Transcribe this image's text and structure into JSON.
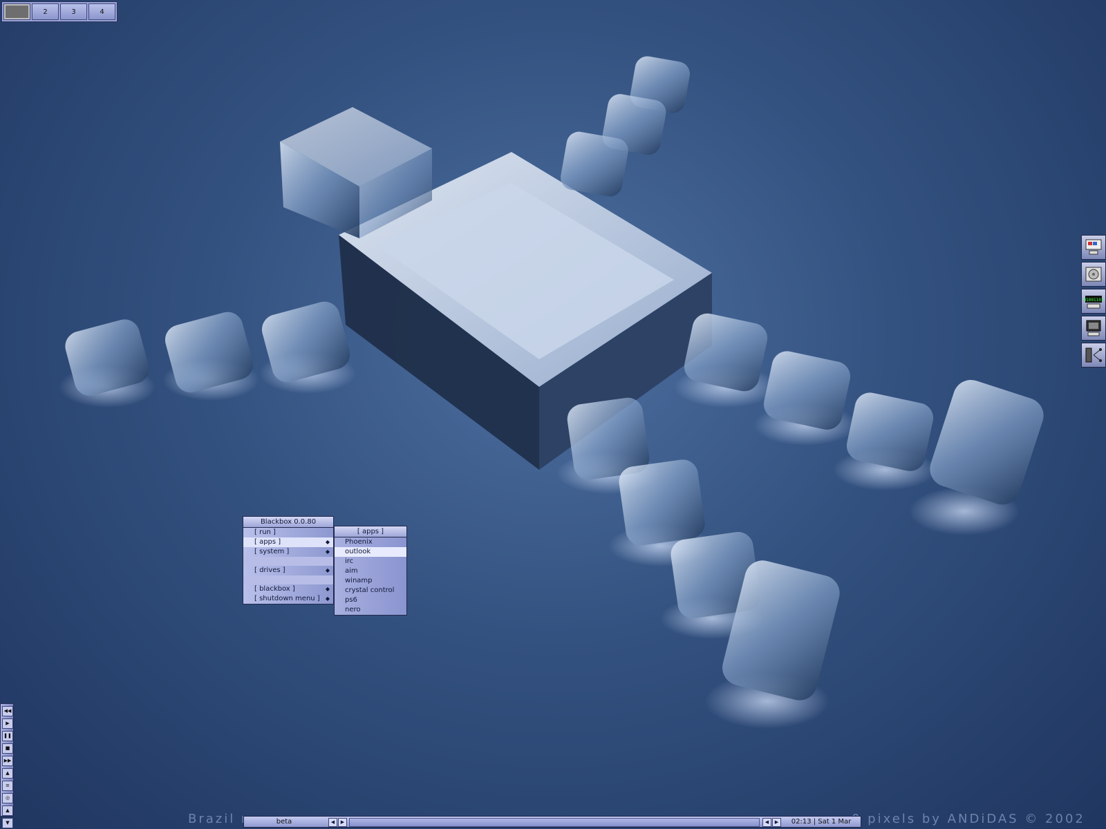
{
  "pager": {
    "desktops": [
      "",
      "2",
      "3",
      "4"
    ],
    "active_index": 0
  },
  "menu": {
    "title": "Blackbox 0.0.80",
    "items": [
      {
        "label": "[ run ]",
        "submenu": false
      },
      {
        "label": "[ apps ]",
        "submenu": true,
        "selected": true
      },
      {
        "label": "[ system ]",
        "submenu": true
      },
      {
        "label": "[ drives ]",
        "submenu": true
      },
      {
        "label": "[ blackbox ]",
        "submenu": true
      },
      {
        "label": "[ shutdown menu ]",
        "submenu": true
      }
    ],
    "submenu_arrow": "◆"
  },
  "apps_menu": {
    "title": "[ apps ]",
    "items": [
      "Phoenix",
      "outlook",
      "irc",
      "aim",
      "winamp",
      "crystal control",
      "ps6",
      "nero"
    ],
    "selected": "outlook"
  },
  "dock": {
    "icons": [
      "monitor-icon",
      "cd-drive-icon",
      "binary-display-icon",
      "computer-icon",
      "network-icon"
    ],
    "binary_text": "01001101"
  },
  "mediabar": {
    "buttons": [
      {
        "icon": "rewind-icon",
        "glyph": "◀◀"
      },
      {
        "icon": "play-icon",
        "glyph": "▶"
      },
      {
        "icon": "pause-icon",
        "glyph": "❚❚"
      },
      {
        "icon": "stop-icon",
        "glyph": "■"
      },
      {
        "icon": "fast-forward-icon",
        "glyph": "▶▶"
      },
      {
        "icon": "eject-icon",
        "glyph": "▲"
      },
      {
        "icon": "playlist-icon",
        "glyph": "≡"
      },
      {
        "icon": "settings-icon",
        "glyph": "◎"
      },
      {
        "icon": "up-icon",
        "glyph": "▲"
      },
      {
        "icon": "down-icon",
        "glyph": "▼"
      }
    ]
  },
  "taskbar": {
    "workspace_label": "beta",
    "clock": "02:13 | Sat 1 Mar"
  },
  "credit": "Brazil r",
  "credit_right": "0 pixels by ANDiDAS © 2002",
  "colors": {
    "background": "#33517f",
    "menu": "#b7bde6",
    "menu_highlight": "#e2e6fb"
  }
}
